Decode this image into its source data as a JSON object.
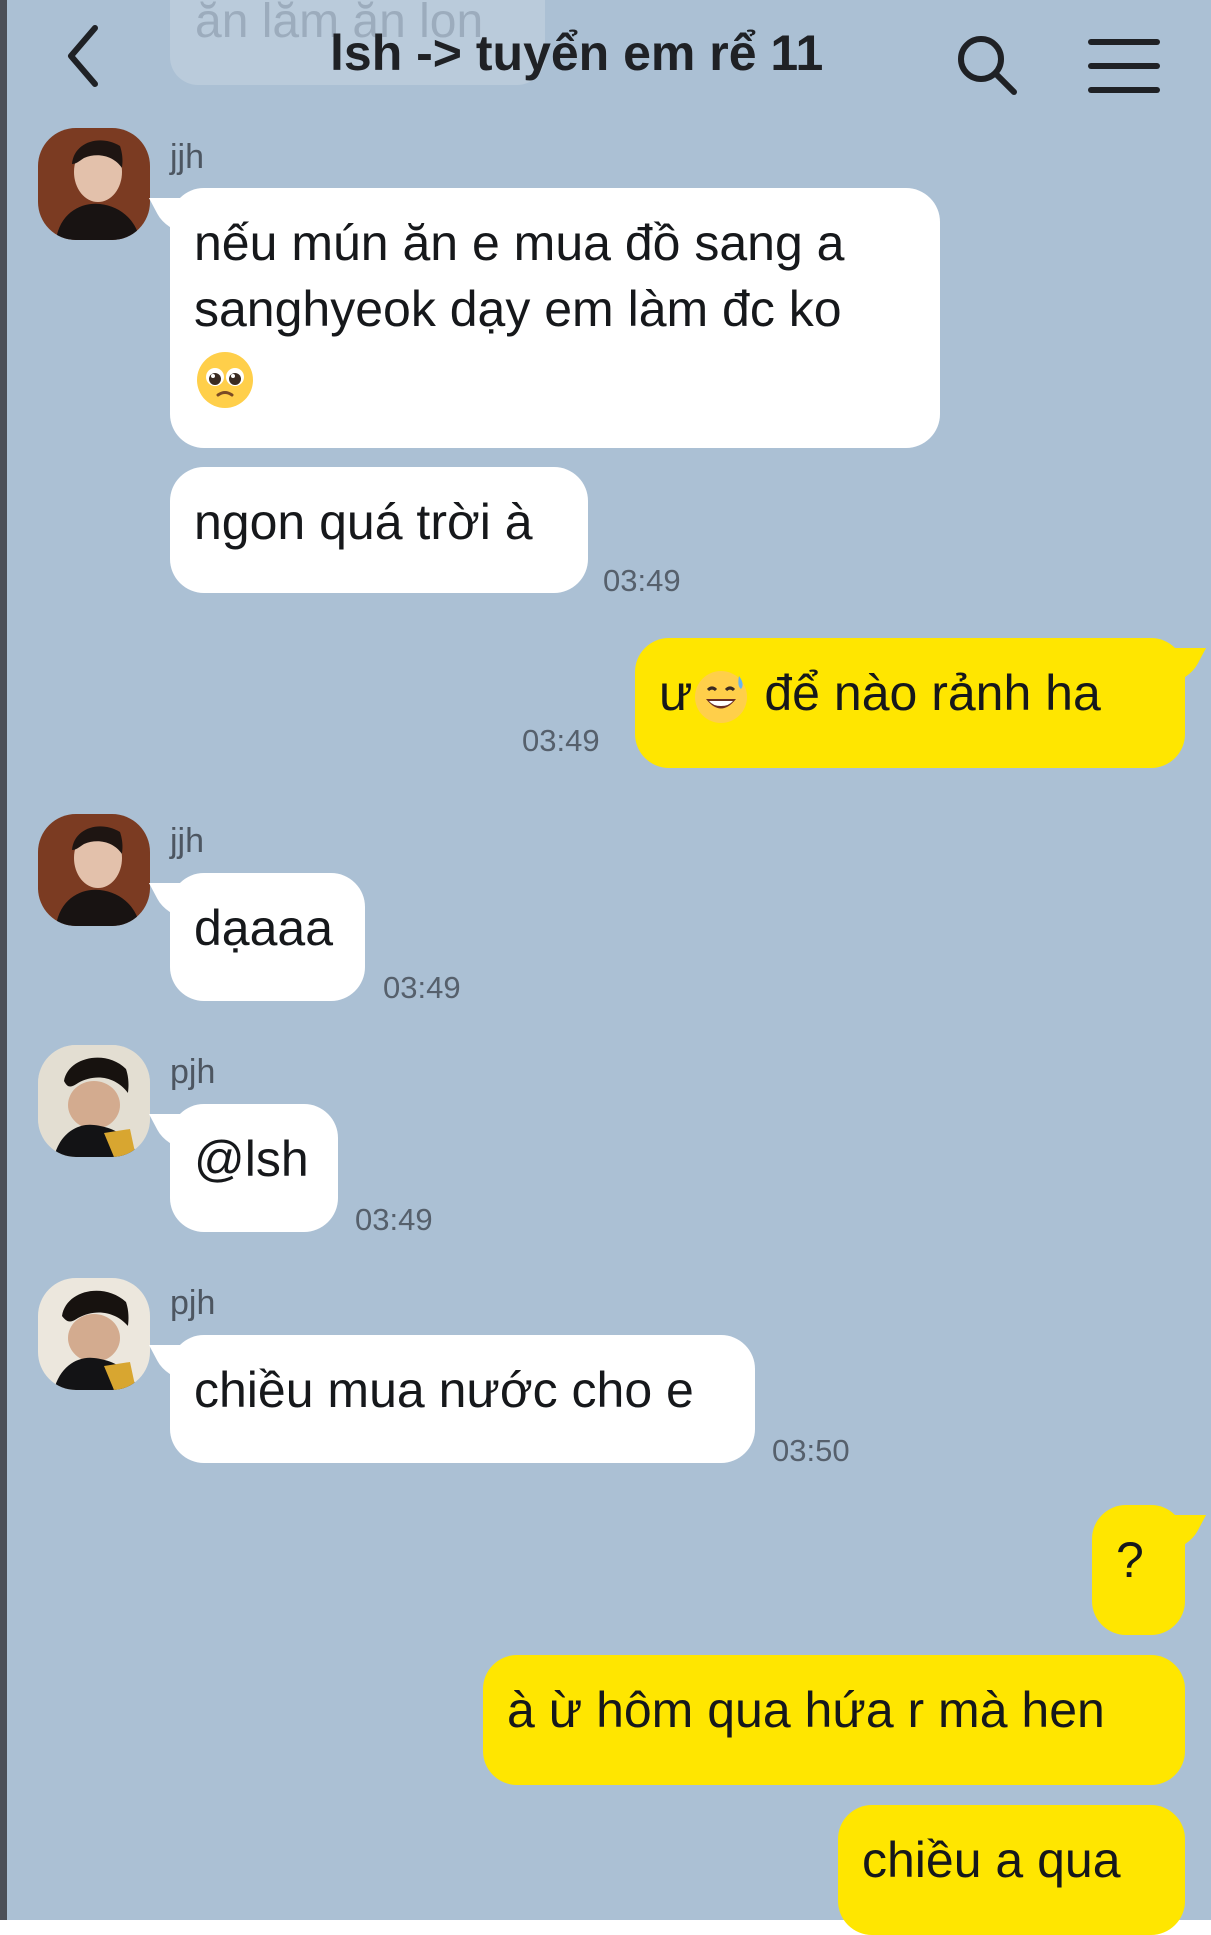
{
  "header": {
    "title": "lsh -> tuyển em rể 11",
    "cutoff_message_preview": "ăn lăm ăn lon"
  },
  "colors": {
    "background": "#abc0d4",
    "incoming_bubble": "#ffffff",
    "outgoing_bubble": "#ffe600",
    "text": "#16181b"
  },
  "icons": {
    "back": "back-chevron-icon",
    "search": "search-icon",
    "menu": "hamburger-menu-icon",
    "emoji_pleading": "pleading-face-emoji",
    "emoji_sweat_smile": "sweat-smile-emoji"
  },
  "messages": [
    {
      "sender": "jjh",
      "text_line1": "nếu mún ăn e mua đồ sang a",
      "text_line2": "sanghyeok dạy em làm đc ko"
    },
    {
      "sender": "jjh",
      "text": "ngon quá trời à",
      "time": "03:49"
    },
    {
      "sender": "me",
      "text_prefix": "ư",
      "text_suffix": " để nào rảnh ha",
      "time": "03:49"
    },
    {
      "sender": "jjh",
      "text": "dạaaa",
      "time": "03:49"
    },
    {
      "sender": "pjh",
      "text": "@lsh",
      "time": "03:49"
    },
    {
      "sender": "pjh",
      "text": "chiều mua nước cho e",
      "time": "03:50"
    },
    {
      "sender": "me",
      "text": "?"
    },
    {
      "sender": "me",
      "text": "à ừ hôm qua hứa r mà hen"
    },
    {
      "sender": "me",
      "text": "chiều a qua"
    }
  ]
}
